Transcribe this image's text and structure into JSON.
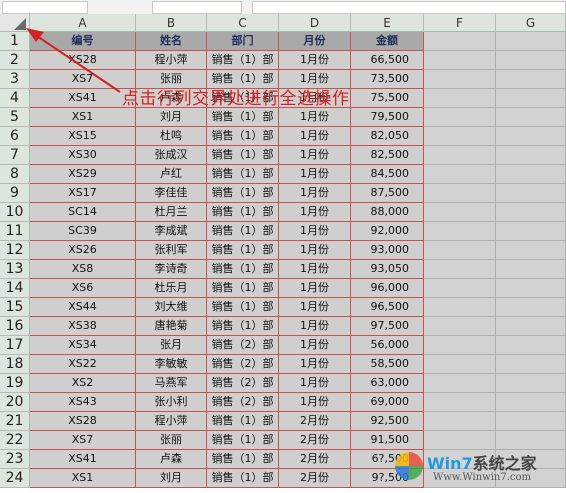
{
  "annotation": "点击行列交界处进行全选操作",
  "column_headers": [
    "A",
    "B",
    "C",
    "D",
    "E",
    "F",
    "G"
  ],
  "table_headers": [
    "编号",
    "姓名",
    "部门",
    "月份",
    "金额"
  ],
  "rows": [
    [
      "XS28",
      "程小萍",
      "销售（1）部",
      "1月份",
      "66,500"
    ],
    [
      "XS7",
      "张丽",
      "销售（1）部",
      "1月份",
      "73,500"
    ],
    [
      "XS41",
      "卢森",
      "销售（1）部",
      "1月份",
      "75,500"
    ],
    [
      "XS1",
      "刘月",
      "销售（1）部",
      "1月份",
      "79,500"
    ],
    [
      "XS15",
      "杜鸣",
      "销售（1）部",
      "1月份",
      "82,050"
    ],
    [
      "XS30",
      "张成汉",
      "销售（1）部",
      "1月份",
      "82,500"
    ],
    [
      "XS29",
      "卢红",
      "销售（1）部",
      "1月份",
      "84,500"
    ],
    [
      "XS17",
      "李佳佳",
      "销售（1）部",
      "1月份",
      "87,500"
    ],
    [
      "SC14",
      "杜月兰",
      "销售（1）部",
      "1月份",
      "88,000"
    ],
    [
      "SC39",
      "李成斌",
      "销售（1）部",
      "1月份",
      "92,000"
    ],
    [
      "XS26",
      "张利军",
      "销售（1）部",
      "1月份",
      "93,000"
    ],
    [
      "XS8",
      "李诗奇",
      "销售（1）部",
      "1月份",
      "93,050"
    ],
    [
      "XS6",
      "杜乐月",
      "销售（1）部",
      "1月份",
      "96,000"
    ],
    [
      "XS44",
      "刘大维",
      "销售（1）部",
      "1月份",
      "96,500"
    ],
    [
      "XS38",
      "唐艳菊",
      "销售（1）部",
      "1月份",
      "97,500"
    ],
    [
      "XS34",
      "张月",
      "销售（2）部",
      "1月份",
      "56,000"
    ],
    [
      "XS22",
      "李敏敏",
      "销售（2）部",
      "1月份",
      "58,500"
    ],
    [
      "XS2",
      "马燕军",
      "销售（2）部",
      "1月份",
      "63,000"
    ],
    [
      "XS43",
      "张小利",
      "销售（2）部",
      "1月份",
      "69,000"
    ],
    [
      "XS28",
      "程小萍",
      "销售（1）部",
      "2月份",
      "92,500"
    ],
    [
      "XS7",
      "张丽",
      "销售（1）部",
      "2月份",
      "91,500"
    ],
    [
      "XS41",
      "卢森",
      "销售（1）部",
      "2月份",
      "6?,500"
    ],
    [
      "XS1",
      "刘月",
      "销售（1）部",
      "2月份",
      "9?,500"
    ]
  ],
  "watermark": {
    "brand_a": "Win7",
    "brand_b": "系统之家",
    "url": "Www.Winwin7.com"
  }
}
